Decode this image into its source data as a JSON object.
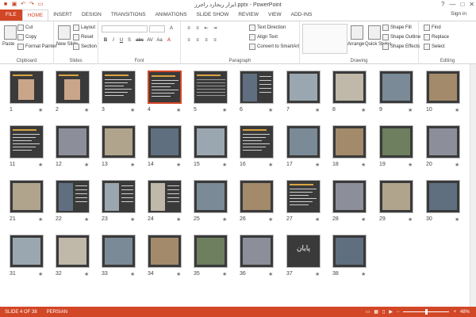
{
  "window": {
    "title": "ابزار ریجارد راجرز.pptx - PowerPoint",
    "sign_in": "Sign in",
    "controls": [
      "?",
      "—",
      "□",
      "✕"
    ]
  },
  "tabs": [
    "FILE",
    "HOME",
    "INSERT",
    "DESIGN",
    "TRANSITIONS",
    "ANIMATIONS",
    "SLIDE SHOW",
    "REVIEW",
    "VIEW",
    "ADD-INS"
  ],
  "active_tab": "HOME",
  "ribbon": {
    "clipboard": {
      "label": "Clipboard",
      "paste": "Paste",
      "cut": "Cut",
      "copy": "Copy",
      "format_painter": "Format Painter"
    },
    "slides": {
      "label": "Slides",
      "new_slide": "New Slide",
      "layout": "Layout",
      "reset": "Reset",
      "section": "Section"
    },
    "font": {
      "label": "Font",
      "buttons": [
        "B",
        "I",
        "U",
        "S",
        "abc",
        "AV",
        "Aa",
        "A"
      ]
    },
    "paragraph": {
      "label": "Paragraph",
      "text_direction": "Text Direction",
      "align_text": "Align Text",
      "convert_smartart": "Convert to SmartArt"
    },
    "drawing": {
      "label": "Drawing",
      "arrange": "Arrange",
      "quick_styles": "Quick Styles",
      "shape_fill": "Shape Fill",
      "shape_outline": "Shape Outline",
      "shape_effects": "Shape Effects"
    },
    "editing": {
      "label": "Editing",
      "find": "Find",
      "replace": "Replace",
      "select": "Select"
    }
  },
  "slides": [
    {
      "n": "1",
      "star": "★",
      "kind": "portrait"
    },
    {
      "n": "2",
      "star": "★",
      "kind": "portrait"
    },
    {
      "n": "3",
      "star": "★",
      "kind": "text"
    },
    {
      "n": "4",
      "star": "★",
      "kind": "text",
      "selected": true
    },
    {
      "n": "5",
      "star": "★",
      "kind": "table"
    },
    {
      "n": "6",
      "star": "★",
      "kind": "building"
    },
    {
      "n": "7",
      "star": "★",
      "kind": "photo"
    },
    {
      "n": "8",
      "star": "★",
      "kind": "photo"
    },
    {
      "n": "9",
      "star": "★",
      "kind": "photo"
    },
    {
      "n": "10",
      "star": "★",
      "kind": "photo"
    },
    {
      "n": "11",
      "star": "★",
      "kind": "text"
    },
    {
      "n": "12",
      "star": "★",
      "kind": "photo"
    },
    {
      "n": "13",
      "star": "★",
      "kind": "photo"
    },
    {
      "n": "14",
      "star": "★",
      "kind": "photo"
    },
    {
      "n": "15",
      "star": "★",
      "kind": "photo"
    },
    {
      "n": "16",
      "star": "★",
      "kind": "text"
    },
    {
      "n": "17",
      "star": "★",
      "kind": "photo"
    },
    {
      "n": "18",
      "star": "★",
      "kind": "photo"
    },
    {
      "n": "19",
      "star": "★",
      "kind": "photo"
    },
    {
      "n": "20",
      "star": "★",
      "kind": "photo"
    },
    {
      "n": "21",
      "star": "★",
      "kind": "photo"
    },
    {
      "n": "22",
      "star": "★",
      "kind": "building"
    },
    {
      "n": "23",
      "star": "★",
      "kind": "building"
    },
    {
      "n": "24",
      "star": "★",
      "kind": "building"
    },
    {
      "n": "25",
      "star": "★",
      "kind": "photo"
    },
    {
      "n": "26",
      "star": "★",
      "kind": "photo"
    },
    {
      "n": "27",
      "star": "★",
      "kind": "text"
    },
    {
      "n": "28",
      "star": "★",
      "kind": "photo"
    },
    {
      "n": "29",
      "star": "★",
      "kind": "photo"
    },
    {
      "n": "30",
      "star": "★",
      "kind": "photo"
    },
    {
      "n": "31",
      "star": "★",
      "kind": "photo"
    },
    {
      "n": "32",
      "star": "★",
      "kind": "photo"
    },
    {
      "n": "33",
      "star": "★",
      "kind": "photo"
    },
    {
      "n": "34",
      "star": "★",
      "kind": "photo"
    },
    {
      "n": "35",
      "star": "★",
      "kind": "photo"
    },
    {
      "n": "36",
      "star": "★",
      "kind": "photo"
    },
    {
      "n": "37",
      "star": "★",
      "kind": "end",
      "caption": "پایان"
    },
    {
      "n": "38",
      "star": "★",
      "kind": "photo"
    }
  ],
  "status": {
    "slide_info": "SLIDE 4 OF 38",
    "language": "PERSIAN",
    "zoom": "48%",
    "zoom_fraction": 0.48
  },
  "colors": {
    "accent": "#d24726",
    "slide_bg": "#3a3a3a"
  }
}
